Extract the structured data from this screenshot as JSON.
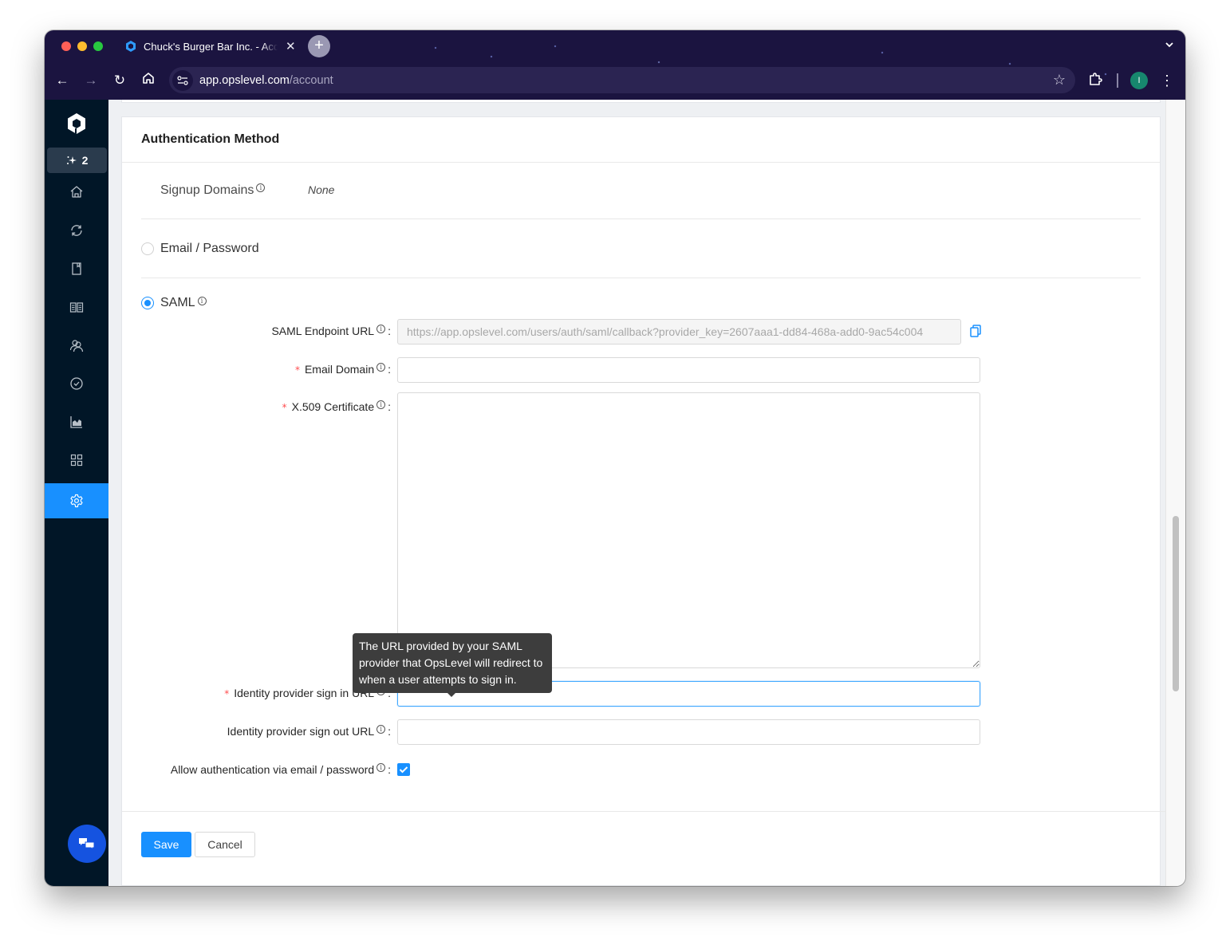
{
  "browser": {
    "tab_title": "Chuck's Burger Bar Inc. - Account",
    "url_host": "app.opslevel.com",
    "url_path": "/account",
    "profile_initial": "I",
    "new_tab_label": "+",
    "tab_close_label": "✕",
    "tab_menu_label": "⌄",
    "nav": {
      "back": "←",
      "forward": "→",
      "reload": "↻",
      "home": "⌂"
    },
    "star_label": "☆",
    "menu_label": "⋮"
  },
  "sidebar": {
    "ai_badge_count": "2",
    "items": [
      {
        "name": "home",
        "icon": "home-icon"
      },
      {
        "name": "sync",
        "icon": "sync-icon"
      },
      {
        "name": "catalog",
        "icon": "book-icon"
      },
      {
        "name": "docs",
        "icon": "open-book-icon"
      },
      {
        "name": "teams",
        "icon": "users-icon"
      },
      {
        "name": "checks",
        "icon": "check-circle-icon"
      },
      {
        "name": "reports",
        "icon": "area-chart-icon"
      },
      {
        "name": "integrations",
        "icon": "grid-icon"
      },
      {
        "name": "settings",
        "icon": "gear-icon",
        "active": true
      }
    ],
    "accent": "#1890ff"
  },
  "card": {
    "title": "Authentication Method",
    "signup_domains_label": "Signup Domains",
    "signup_domains_value": "None",
    "email_password_label": "Email / Password",
    "email_password_selected": false,
    "saml_label": "SAML",
    "saml_selected": true
  },
  "saml_form": {
    "endpoint_label": "SAML Endpoint URL",
    "endpoint_value": "https://app.opslevel.com/users/auth/saml/callback?provider_key=2607aaa1-dd84-468a-add0-9ac54c004",
    "email_domain_label": "Email Domain",
    "email_domain_value": "",
    "certificate_label": "X.509 Certificate",
    "certificate_value": "",
    "signin_url_label": "Identity provider sign in URL",
    "signin_url_value": "",
    "signout_url_label": "Identity provider sign out URL",
    "signout_url_value": "",
    "allow_password_label": "Allow authentication via email / password",
    "allow_password_checked": true,
    "required_mark": "*",
    "colon": ":",
    "info_glyph": "i"
  },
  "tooltip": {
    "text": "The URL provided by your SAML provider that OpsLevel will redirect to when a user attempts to sign in."
  },
  "footer": {
    "save_label": "Save",
    "cancel_label": "Cancel"
  }
}
